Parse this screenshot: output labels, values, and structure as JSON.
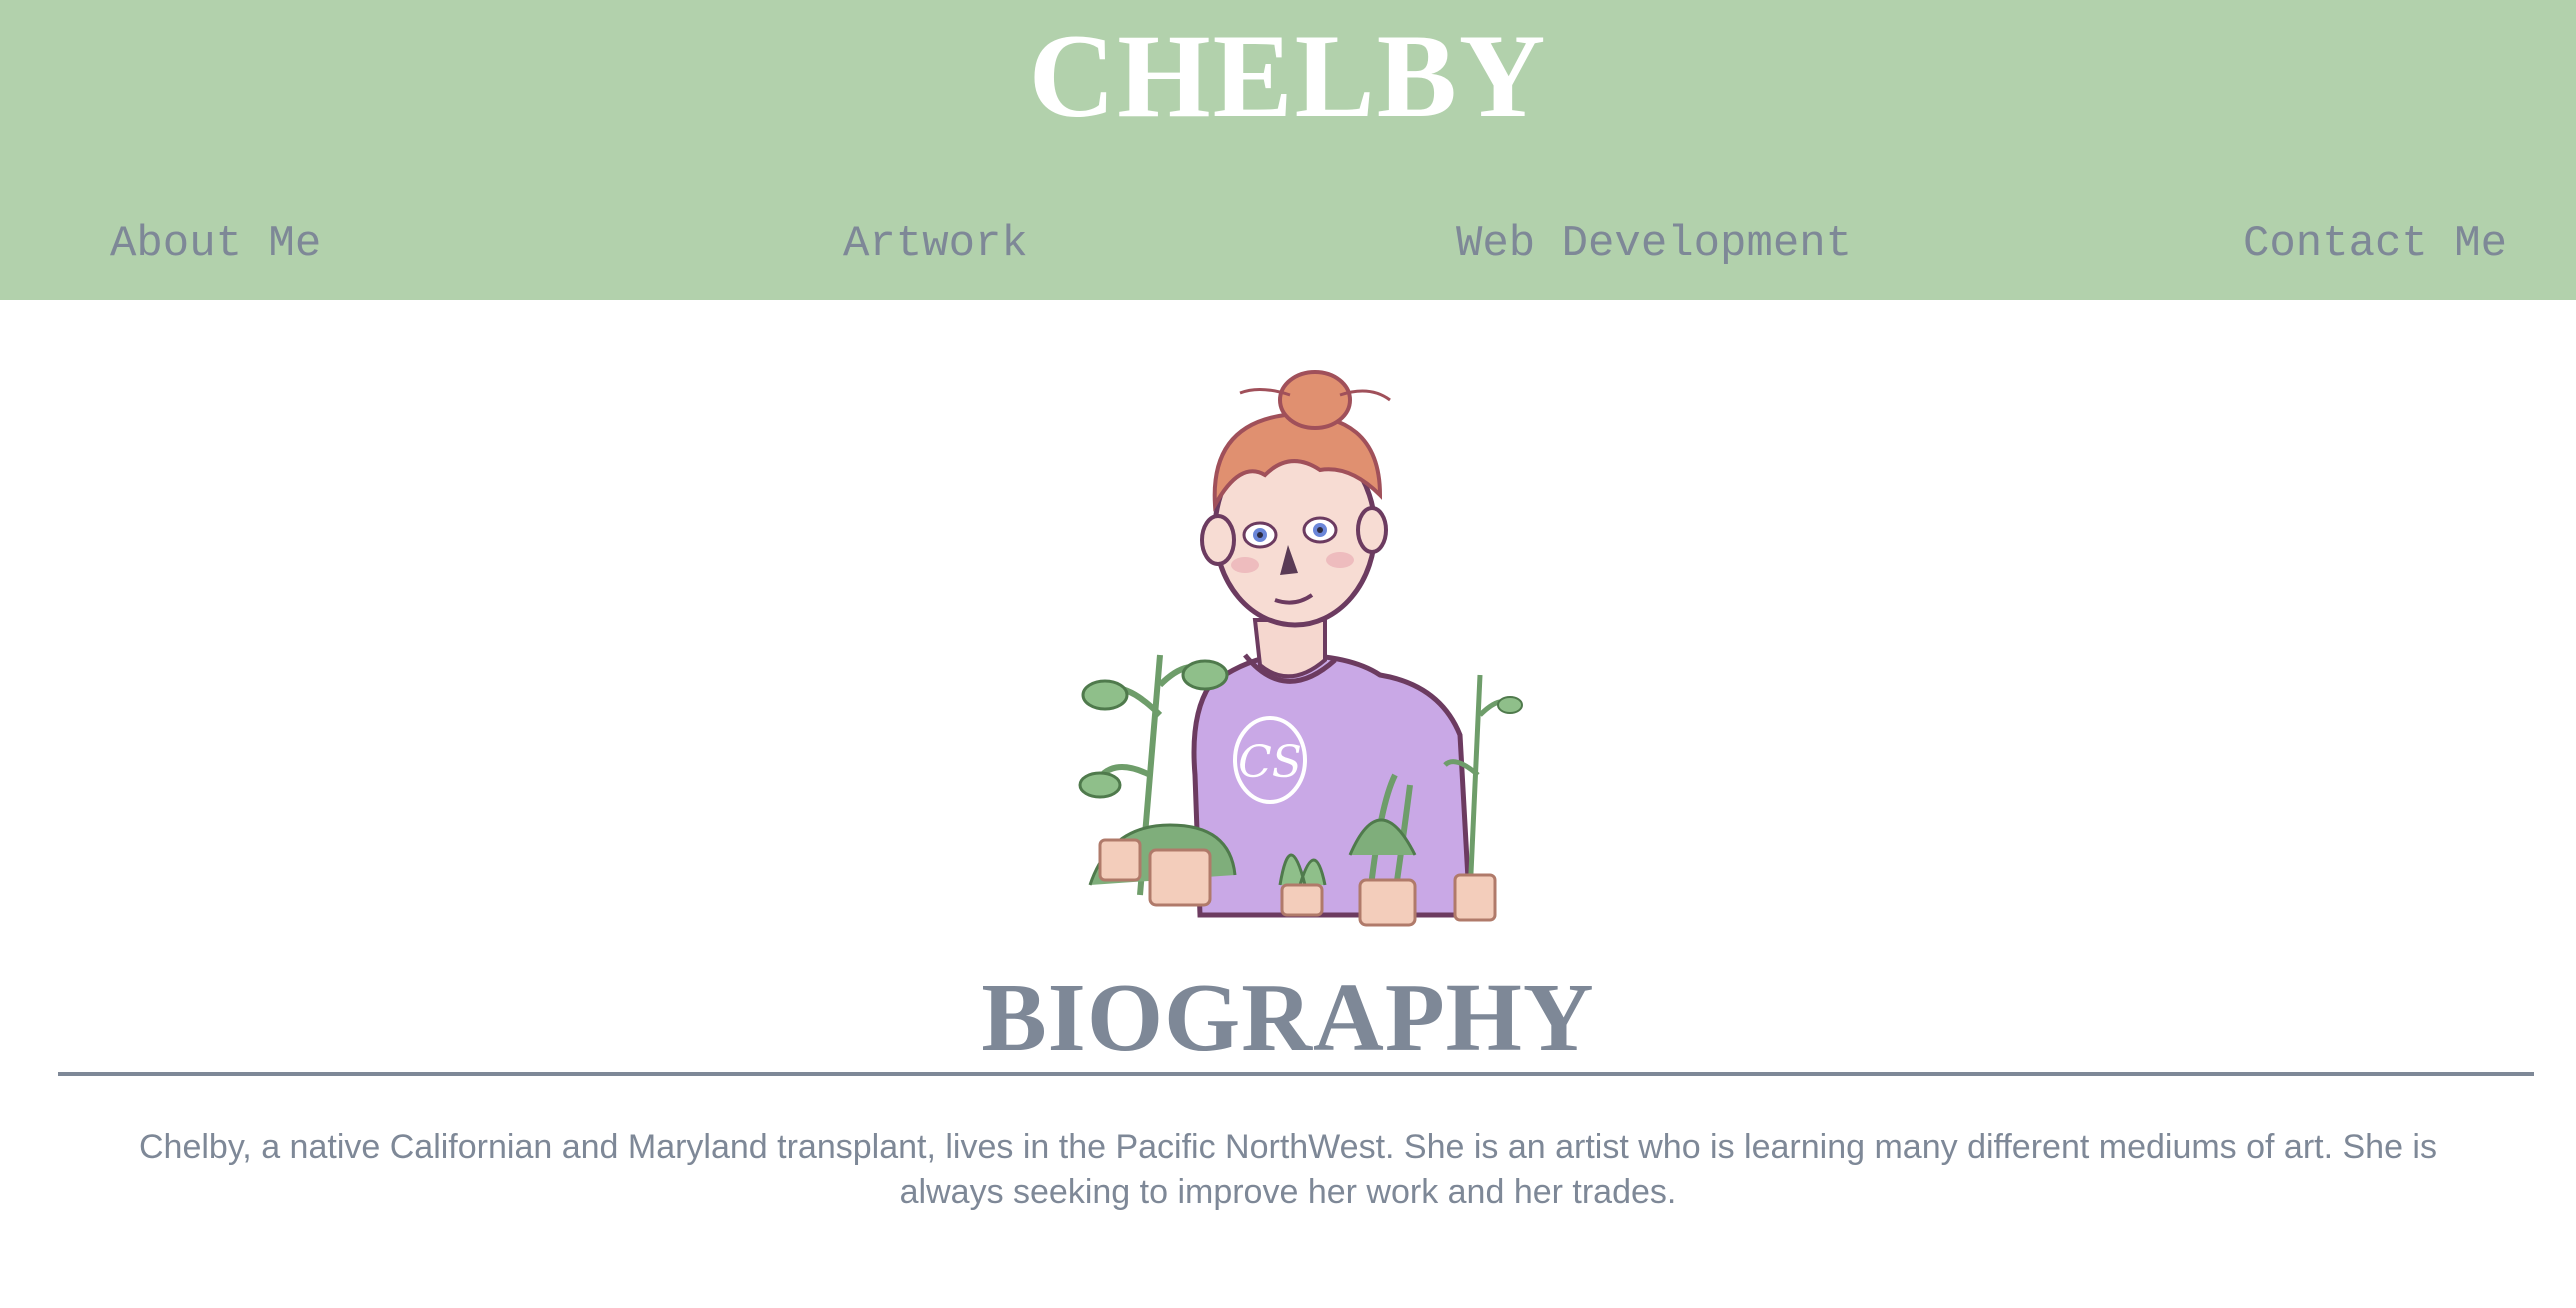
{
  "header": {
    "title": "CHELBY",
    "background": "#b2d1ac"
  },
  "nav": {
    "about": "About Me",
    "artwork": "Artwork",
    "webdev": "Web Development",
    "contact": "Contact Me"
  },
  "main": {
    "portrait_icon": "illustrated-self-portrait-with-plants",
    "portrait_shirt_monogram": "CS",
    "section_title": "BIOGRAPHY",
    "bio": "Chelby, a native Californian and Maryland transplant, lives in the Pacific NorthWest. She is an artist who is learning many different mediums of art. She is always seeking to improve her work and her trades."
  },
  "colors": {
    "accent_text": "#7e8897",
    "title_text": "#ffffff"
  }
}
